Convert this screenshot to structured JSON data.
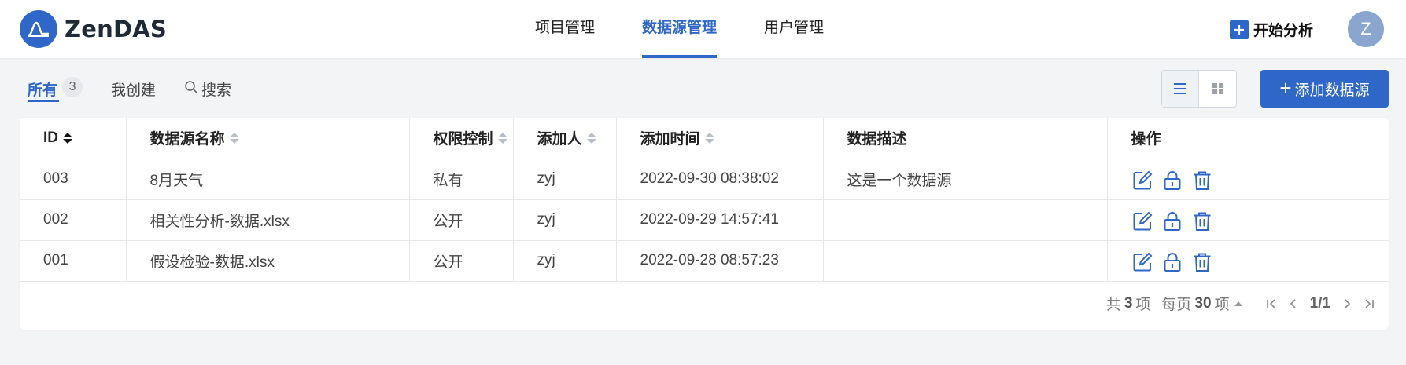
{
  "app": {
    "name": "ZenDAS"
  },
  "nav": {
    "items": [
      "项目管理",
      "数据源管理",
      "用户管理"
    ],
    "active_index": 1
  },
  "header": {
    "start_label": "开始分析",
    "avatar_letter": "Z"
  },
  "filters": {
    "all_label": "所有",
    "all_count": "3",
    "mine_label": "我创建",
    "search_label": "搜索"
  },
  "toolbar": {
    "add_label": "添加数据源",
    "view_mode": "list"
  },
  "table": {
    "columns": [
      "ID",
      "数据源名称",
      "权限控制",
      "添加人",
      "添加时间",
      "数据描述",
      "操作"
    ],
    "rows": [
      {
        "id": "003",
        "name": "8月天气",
        "permission": "私有",
        "creator": "zyj",
        "time": "2022-09-30 08:38:02",
        "desc": "这是一个数据源"
      },
      {
        "id": "002",
        "name": "相关性分析-数据.xlsx",
        "permission": "公开",
        "creator": "zyj",
        "time": "2022-09-29 14:57:41",
        "desc": ""
      },
      {
        "id": "001",
        "name": "假设检验-数据.xlsx",
        "permission": "公开",
        "creator": "zyj",
        "time": "2022-09-28 08:57:23",
        "desc": ""
      }
    ]
  },
  "pager": {
    "total_prefix": "共",
    "total": "3",
    "total_suffix": "项",
    "per_prefix": "每页",
    "per_page": "30",
    "per_suffix": "项",
    "pages": "1/1"
  },
  "colors": {
    "accent": "#2f67c9",
    "avatar": "#8aa6cf"
  }
}
